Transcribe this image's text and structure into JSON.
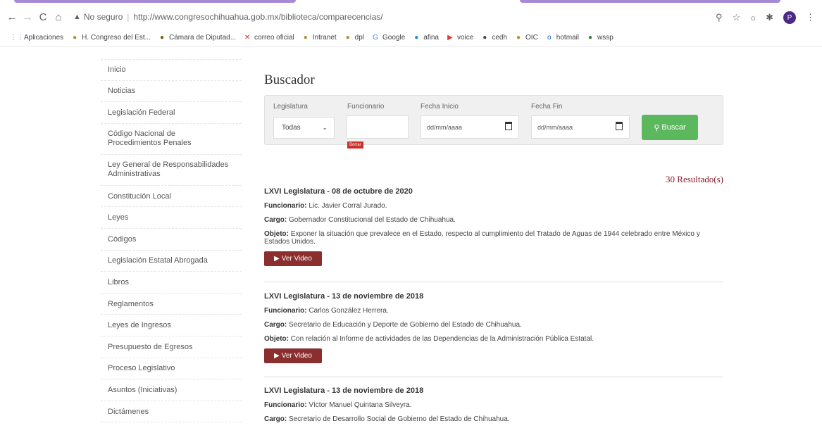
{
  "browser": {
    "warning": "No seguro",
    "url": "http://www.congresochihuahua.gob.mx/biblioteca/comparecencias/",
    "profile_initial": "P"
  },
  "bookmarks": [
    {
      "label": "Aplicaciones",
      "icon": "apps-grid-icon",
      "color": "#4285f4",
      "glyph": "⋮⋮"
    },
    {
      "label": "H. Congreso del Est...",
      "icon": "congress-seal-icon",
      "color": "#b58b2d",
      "glyph": "●"
    },
    {
      "label": "Cámara de Diputad...",
      "icon": "chamber-seal-icon",
      "color": "#7a5a1a",
      "glyph": "●"
    },
    {
      "label": "correo oficial",
      "icon": "x-mail-icon",
      "color": "#d32f2f",
      "glyph": "✕"
    },
    {
      "label": "Intranet",
      "icon": "intranet-icon",
      "color": "#b58b2d",
      "glyph": "●"
    },
    {
      "label": "dpl",
      "icon": "dpl-icon",
      "color": "#b58b2d",
      "glyph": "●"
    },
    {
      "label": "Google",
      "icon": "google-icon",
      "color": "#4285f4",
      "glyph": "G"
    },
    {
      "label": "afina",
      "icon": "afina-icon",
      "color": "#1e88e5",
      "glyph": "●"
    },
    {
      "label": "voice",
      "icon": "youtube-icon",
      "color": "#e53935",
      "glyph": "▶"
    },
    {
      "label": "cedh",
      "icon": "cedh-icon",
      "color": "#444444",
      "glyph": "●"
    },
    {
      "label": "OIC",
      "icon": "oic-icon",
      "color": "#b58b2d",
      "glyph": "●"
    },
    {
      "label": "hotmail",
      "icon": "outlook-icon",
      "color": "#1565c0",
      "glyph": "o"
    },
    {
      "label": "wssp",
      "icon": "whatsapp-icon",
      "color": "#2e7d32",
      "glyph": "●"
    }
  ],
  "sidebar": {
    "items": [
      {
        "label": "Inicio",
        "tall": false
      },
      {
        "label": "Noticias",
        "tall": false
      },
      {
        "label": "Legislación Federal",
        "tall": false
      },
      {
        "label": "Código Nacional de\nProcedimientos Penales",
        "tall": true
      },
      {
        "label": "Ley General de Responsabilidades\nAdministrativas",
        "tall": true
      },
      {
        "label": "Constitución Local",
        "tall": false
      },
      {
        "label": "Leyes",
        "tall": false
      },
      {
        "label": "Códigos",
        "tall": false
      },
      {
        "label": "Legislación Estatal Abrogada",
        "tall": false
      },
      {
        "label": "Libros",
        "tall": false
      },
      {
        "label": "Reglamentos",
        "tall": false
      },
      {
        "label": "Leyes de Ingresos",
        "tall": false
      },
      {
        "label": "Presupuesto de Egresos",
        "tall": false
      },
      {
        "label": "Proceso Legislativo",
        "tall": false
      },
      {
        "label": "Asuntos (Iniciativas)",
        "tall": false
      },
      {
        "label": "Dictámenes",
        "tall": false
      }
    ]
  },
  "search": {
    "title": "Buscador",
    "legislatura_label": "Legislatura",
    "legislatura_value": "Todas",
    "funcionario_label": "Funcionario",
    "funcionario_value": "",
    "borrar_label": "Borrar",
    "fecha_inicio_label": "Fecha Inicio",
    "fecha_inicio_placeholder": "dd/mm/aaaa",
    "fecha_fin_label": "Fecha Fin",
    "fecha_fin_placeholder": "dd/mm/aaaa",
    "buscar_label": "Buscar",
    "results_count": "30 Resultado(s)"
  },
  "labels": {
    "funcionario": "Funcionario:",
    "cargo": "Cargo:",
    "objeto": "Objeto:",
    "ver_video": "Ver Video"
  },
  "results": [
    {
      "title": "LXVI Legislatura - 08 de octubre de 2020",
      "funcionario": "Lic. Javier Corral Jurado.",
      "cargo": "Gobernador Constitucional del Estado de Chihuahua.",
      "objeto": "Exponer la situación que prevalece en el Estado, respecto al cumplimiento del Tratado de Aguas de 1944 celebrado entre México y Estados Unidos."
    },
    {
      "title": "LXVI Legislatura - 13 de noviembre de 2018",
      "funcionario": "Carlos González Herrera.",
      "cargo": "Secretario de Educación y Deporte de Gobierno del Estado de Chihuahua.",
      "objeto": "Con relación al Informe de actividades de las Dependencias de la Administración Pública Estatal."
    },
    {
      "title": "LXVI Legislatura - 13 de noviembre de 2018",
      "funcionario": "Víctor Manuel Quintana Silveyra.",
      "cargo": "Secretario de Desarrollo Social de Gobierno del Estado de Chihuahua.",
      "objeto": ""
    }
  ]
}
